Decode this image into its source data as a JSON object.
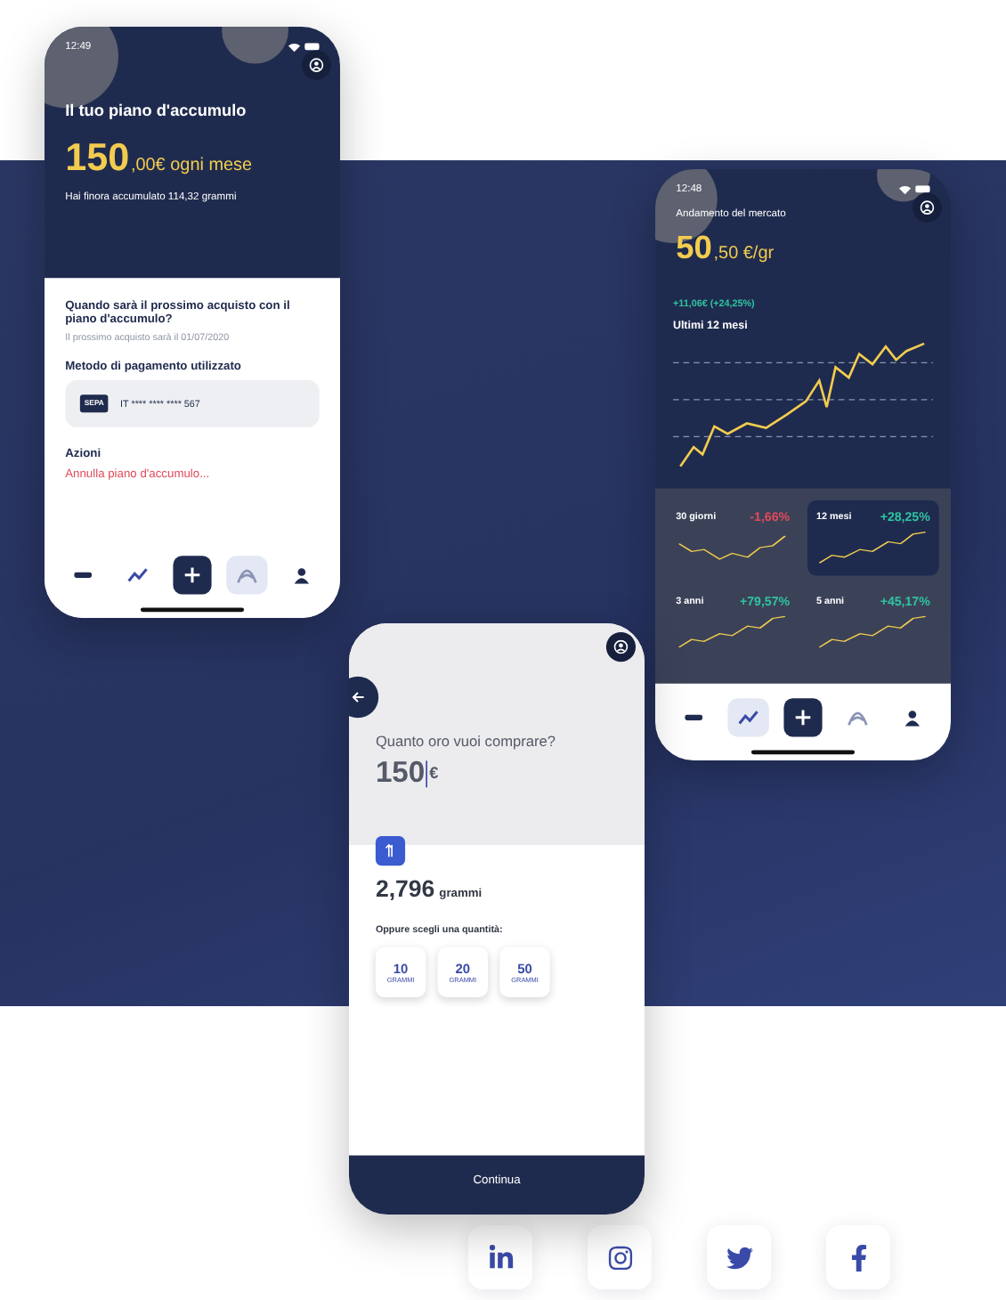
{
  "phones": [
    {
      "kind": "plan",
      "time": "12:49",
      "title": "Il tuo piano d'accumulo",
      "amount": "150",
      "amount_suffix": ",00€ ogni mese",
      "subtitle": "Hai finora accumulato 114,32 grammi",
      "question": "Quando sarà il prossimo acquisto con il piano d'accumulo?",
      "next_purchase": "Il prossimo acquisto sarà il 01/07/2020",
      "payment_label": "Metodo di pagamento utilizzato",
      "card_brand": "SEPA",
      "card_number": "IT **** **** **** 567",
      "actions_label": "Azioni",
      "cancel_link": "Annulla piano d'accumulo...",
      "nav": [
        {
          "kind": "dash",
          "selected": false
        },
        {
          "kind": "chart",
          "selected": false
        },
        {
          "kind": "add",
          "selected": false
        },
        {
          "kind": "logo",
          "selected": true
        },
        {
          "kind": "profile",
          "selected": false
        }
      ]
    },
    {
      "kind": "market",
      "time": "12:48",
      "title": "Andamento del mercato",
      "price": "50",
      "price_suffix": ",50 €/gr",
      "change": "+11,06€ (+24,25%)",
      "chart_title": "Ultimi 12 mesi",
      "periods": [
        {
          "label": "30 giorni",
          "change": "-1,66%",
          "color": "#e04a5a",
          "selected": false
        },
        {
          "label": "12 mesi",
          "change": "+28,25%",
          "color": "#2ec4a0",
          "selected": true
        },
        {
          "label": "3 anni",
          "change": "+79,57%",
          "color": "#2ec4a0",
          "selected": false
        },
        {
          "label": "5 anni",
          "change": "+45,17%",
          "color": "#2ec4a0",
          "selected": false
        }
      ],
      "nav": [
        {
          "kind": "dash",
          "selected": false
        },
        {
          "kind": "chart",
          "selected": true
        },
        {
          "kind": "add",
          "selected": false
        },
        {
          "kind": "logo",
          "selected": false
        },
        {
          "kind": "profile",
          "selected": false
        }
      ]
    },
    {
      "kind": "buy",
      "question": "Quanto oro vuoi comprare?",
      "amount": "150",
      "currency": "€",
      "grams": "2,796",
      "grams_unit": "grammi",
      "choose_label": "Oppure scegli una quantità:",
      "quantities": [
        {
          "value": "10",
          "unit": "GRAMMI"
        },
        {
          "value": "20",
          "unit": "GRAMMI"
        },
        {
          "value": "50",
          "unit": "GRAMMI"
        }
      ],
      "continue": "Continua"
    }
  ],
  "social_links": [
    {
      "kind": "linkedin"
    },
    {
      "kind": "instagram"
    },
    {
      "kind": "twitter"
    },
    {
      "kind": "facebook"
    }
  ]
}
